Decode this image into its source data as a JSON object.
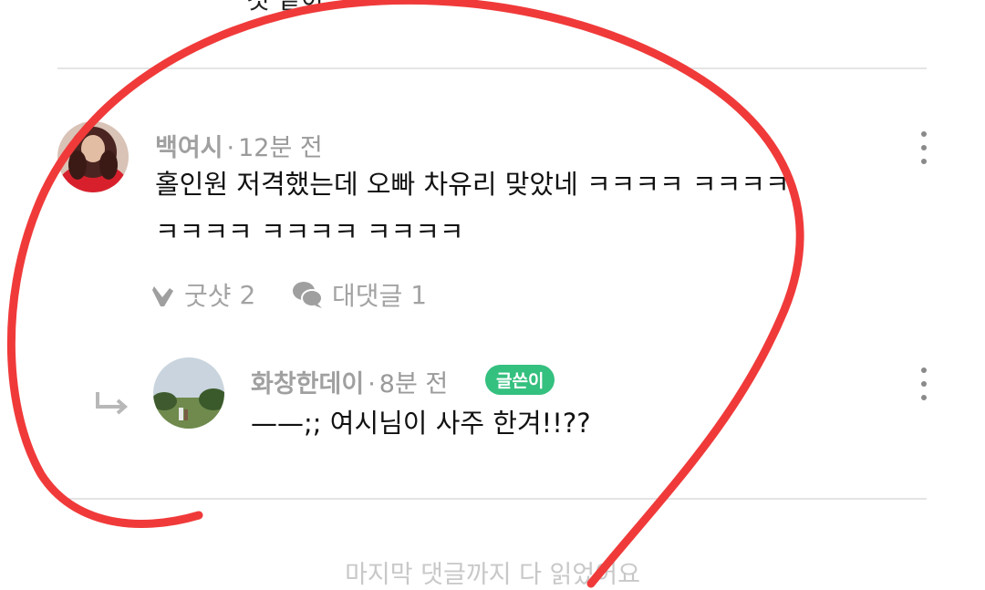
{
  "top_cut_text": "것 같아",
  "comments": [
    {
      "author": "백여시",
      "time": "12분 전",
      "text_line1": "홀인원 저격했는데 오빠 차유리 맞았네 ㅋㅋㅋㅋ ㅋㅋㅋㅋ",
      "text_line2": "ㅋㅋㅋㅋ ㅋㅋㅋㅋ ㅋㅋㅋㅋ",
      "like_label": "굿샷",
      "like_count": "2",
      "reply_label": "대댓글",
      "reply_count": "1"
    }
  ],
  "reply": {
    "author": "화창한데이",
    "time": "8분 전",
    "badge": "글쓴이",
    "text": "——;; 여시님이 사주 한겨!!??"
  },
  "footer": "마지막 댓글까지 다 읽었어요",
  "colors": {
    "badge": "#34c07f",
    "scribble": "#f03a3a"
  }
}
